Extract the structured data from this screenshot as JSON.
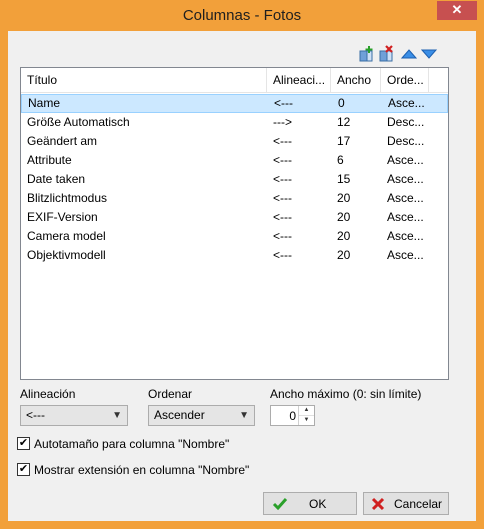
{
  "window": {
    "title": "Columnas - Fotos",
    "close_glyph": "✕"
  },
  "toolbar": {
    "icons": [
      "add-column-icon",
      "remove-column-icon",
      "move-up-icon",
      "move-down-icon"
    ]
  },
  "list": {
    "headers": [
      "Título",
      "Alineaci...",
      "Ancho",
      "Orde..."
    ],
    "rows": [
      [
        "Name",
        "<---",
        "0",
        "Asce..."
      ],
      [
        "Größe Automatisch",
        "--->",
        "12",
        "Desc..."
      ],
      [
        "Geändert am",
        "<---",
        "17",
        "Desc..."
      ],
      [
        "Attribute",
        "<---",
        "6",
        "Asce..."
      ],
      [
        "Date taken",
        "<---",
        "15",
        "Asce..."
      ],
      [
        "Blitzlichtmodus",
        "<---",
        "20",
        "Asce..."
      ],
      [
        "EXIF-Version",
        "<---",
        "20",
        "Asce..."
      ],
      [
        "Camera model",
        "<---",
        "20",
        "Asce..."
      ],
      [
        "Objektivmodell",
        "<---",
        "20",
        "Asce..."
      ]
    ],
    "selected_index": 0
  },
  "options": {
    "alignment_label": "Alineación",
    "alignment_value": "<---",
    "order_label": "Ordenar",
    "order_value": "Ascender",
    "max_width_label": "Ancho máximo (0: sin límite)",
    "max_width_value": "0"
  },
  "checkboxes": {
    "autosize": {
      "label": "Autotamaño para columna \"Nombre\"",
      "checked": true
    },
    "show_ext": {
      "label": "Mostrar extensión en columna \"Nombre\"",
      "checked": true
    }
  },
  "buttons": {
    "ok": "OK",
    "cancel": "Cancelar"
  },
  "colors": {
    "title_bar": "#f2a03a",
    "close": "#c75050",
    "selection": "#cce8ff",
    "ok_check": "#2aa02a",
    "cancel_x": "#d02020"
  }
}
